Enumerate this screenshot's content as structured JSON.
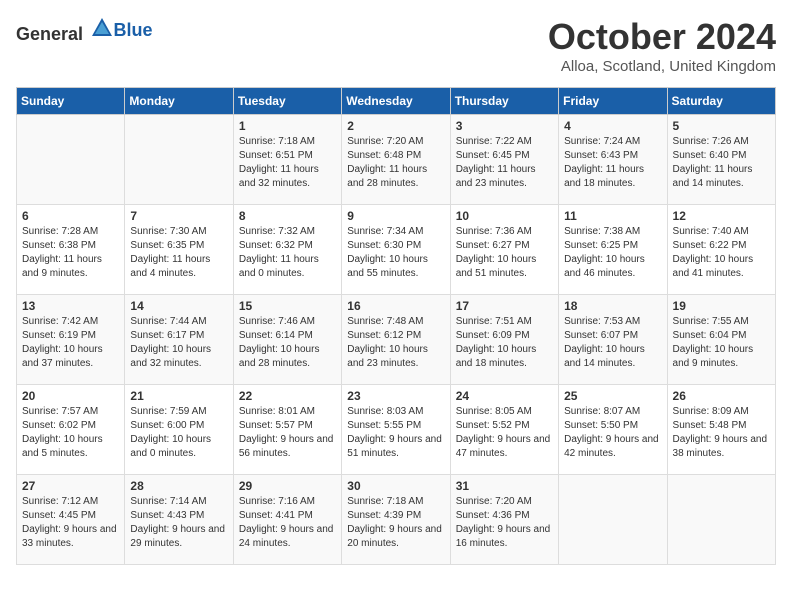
{
  "logo": {
    "text_general": "General",
    "text_blue": "Blue"
  },
  "title": "October 2024",
  "location": "Alloa, Scotland, United Kingdom",
  "weekdays": [
    "Sunday",
    "Monday",
    "Tuesday",
    "Wednesday",
    "Thursday",
    "Friday",
    "Saturday"
  ],
  "weeks": [
    [
      {
        "day": "",
        "sunrise": "",
        "sunset": "",
        "daylight": ""
      },
      {
        "day": "",
        "sunrise": "",
        "sunset": "",
        "daylight": ""
      },
      {
        "day": "1",
        "sunrise": "Sunrise: 7:18 AM",
        "sunset": "Sunset: 6:51 PM",
        "daylight": "Daylight: 11 hours and 32 minutes."
      },
      {
        "day": "2",
        "sunrise": "Sunrise: 7:20 AM",
        "sunset": "Sunset: 6:48 PM",
        "daylight": "Daylight: 11 hours and 28 minutes."
      },
      {
        "day": "3",
        "sunrise": "Sunrise: 7:22 AM",
        "sunset": "Sunset: 6:45 PM",
        "daylight": "Daylight: 11 hours and 23 minutes."
      },
      {
        "day": "4",
        "sunrise": "Sunrise: 7:24 AM",
        "sunset": "Sunset: 6:43 PM",
        "daylight": "Daylight: 11 hours and 18 minutes."
      },
      {
        "day": "5",
        "sunrise": "Sunrise: 7:26 AM",
        "sunset": "Sunset: 6:40 PM",
        "daylight": "Daylight: 11 hours and 14 minutes."
      }
    ],
    [
      {
        "day": "6",
        "sunrise": "Sunrise: 7:28 AM",
        "sunset": "Sunset: 6:38 PM",
        "daylight": "Daylight: 11 hours and 9 minutes."
      },
      {
        "day": "7",
        "sunrise": "Sunrise: 7:30 AM",
        "sunset": "Sunset: 6:35 PM",
        "daylight": "Daylight: 11 hours and 4 minutes."
      },
      {
        "day": "8",
        "sunrise": "Sunrise: 7:32 AM",
        "sunset": "Sunset: 6:32 PM",
        "daylight": "Daylight: 11 hours and 0 minutes."
      },
      {
        "day": "9",
        "sunrise": "Sunrise: 7:34 AM",
        "sunset": "Sunset: 6:30 PM",
        "daylight": "Daylight: 10 hours and 55 minutes."
      },
      {
        "day": "10",
        "sunrise": "Sunrise: 7:36 AM",
        "sunset": "Sunset: 6:27 PM",
        "daylight": "Daylight: 10 hours and 51 minutes."
      },
      {
        "day": "11",
        "sunrise": "Sunrise: 7:38 AM",
        "sunset": "Sunset: 6:25 PM",
        "daylight": "Daylight: 10 hours and 46 minutes."
      },
      {
        "day": "12",
        "sunrise": "Sunrise: 7:40 AM",
        "sunset": "Sunset: 6:22 PM",
        "daylight": "Daylight: 10 hours and 41 minutes."
      }
    ],
    [
      {
        "day": "13",
        "sunrise": "Sunrise: 7:42 AM",
        "sunset": "Sunset: 6:19 PM",
        "daylight": "Daylight: 10 hours and 37 minutes."
      },
      {
        "day": "14",
        "sunrise": "Sunrise: 7:44 AM",
        "sunset": "Sunset: 6:17 PM",
        "daylight": "Daylight: 10 hours and 32 minutes."
      },
      {
        "day": "15",
        "sunrise": "Sunrise: 7:46 AM",
        "sunset": "Sunset: 6:14 PM",
        "daylight": "Daylight: 10 hours and 28 minutes."
      },
      {
        "day": "16",
        "sunrise": "Sunrise: 7:48 AM",
        "sunset": "Sunset: 6:12 PM",
        "daylight": "Daylight: 10 hours and 23 minutes."
      },
      {
        "day": "17",
        "sunrise": "Sunrise: 7:51 AM",
        "sunset": "Sunset: 6:09 PM",
        "daylight": "Daylight: 10 hours and 18 minutes."
      },
      {
        "day": "18",
        "sunrise": "Sunrise: 7:53 AM",
        "sunset": "Sunset: 6:07 PM",
        "daylight": "Daylight: 10 hours and 14 minutes."
      },
      {
        "day": "19",
        "sunrise": "Sunrise: 7:55 AM",
        "sunset": "Sunset: 6:04 PM",
        "daylight": "Daylight: 10 hours and 9 minutes."
      }
    ],
    [
      {
        "day": "20",
        "sunrise": "Sunrise: 7:57 AM",
        "sunset": "Sunset: 6:02 PM",
        "daylight": "Daylight: 10 hours and 5 minutes."
      },
      {
        "day": "21",
        "sunrise": "Sunrise: 7:59 AM",
        "sunset": "Sunset: 6:00 PM",
        "daylight": "Daylight: 10 hours and 0 minutes."
      },
      {
        "day": "22",
        "sunrise": "Sunrise: 8:01 AM",
        "sunset": "Sunset: 5:57 PM",
        "daylight": "Daylight: 9 hours and 56 minutes."
      },
      {
        "day": "23",
        "sunrise": "Sunrise: 8:03 AM",
        "sunset": "Sunset: 5:55 PM",
        "daylight": "Daylight: 9 hours and 51 minutes."
      },
      {
        "day": "24",
        "sunrise": "Sunrise: 8:05 AM",
        "sunset": "Sunset: 5:52 PM",
        "daylight": "Daylight: 9 hours and 47 minutes."
      },
      {
        "day": "25",
        "sunrise": "Sunrise: 8:07 AM",
        "sunset": "Sunset: 5:50 PM",
        "daylight": "Daylight: 9 hours and 42 minutes."
      },
      {
        "day": "26",
        "sunrise": "Sunrise: 8:09 AM",
        "sunset": "Sunset: 5:48 PM",
        "daylight": "Daylight: 9 hours and 38 minutes."
      }
    ],
    [
      {
        "day": "27",
        "sunrise": "Sunrise: 7:12 AM",
        "sunset": "Sunset: 4:45 PM",
        "daylight": "Daylight: 9 hours and 33 minutes."
      },
      {
        "day": "28",
        "sunrise": "Sunrise: 7:14 AM",
        "sunset": "Sunset: 4:43 PM",
        "daylight": "Daylight: 9 hours and 29 minutes."
      },
      {
        "day": "29",
        "sunrise": "Sunrise: 7:16 AM",
        "sunset": "Sunset: 4:41 PM",
        "daylight": "Daylight: 9 hours and 24 minutes."
      },
      {
        "day": "30",
        "sunrise": "Sunrise: 7:18 AM",
        "sunset": "Sunset: 4:39 PM",
        "daylight": "Daylight: 9 hours and 20 minutes."
      },
      {
        "day": "31",
        "sunrise": "Sunrise: 7:20 AM",
        "sunset": "Sunset: 4:36 PM",
        "daylight": "Daylight: 9 hours and 16 minutes."
      },
      {
        "day": "",
        "sunrise": "",
        "sunset": "",
        "daylight": ""
      },
      {
        "day": "",
        "sunrise": "",
        "sunset": "",
        "daylight": ""
      }
    ]
  ]
}
